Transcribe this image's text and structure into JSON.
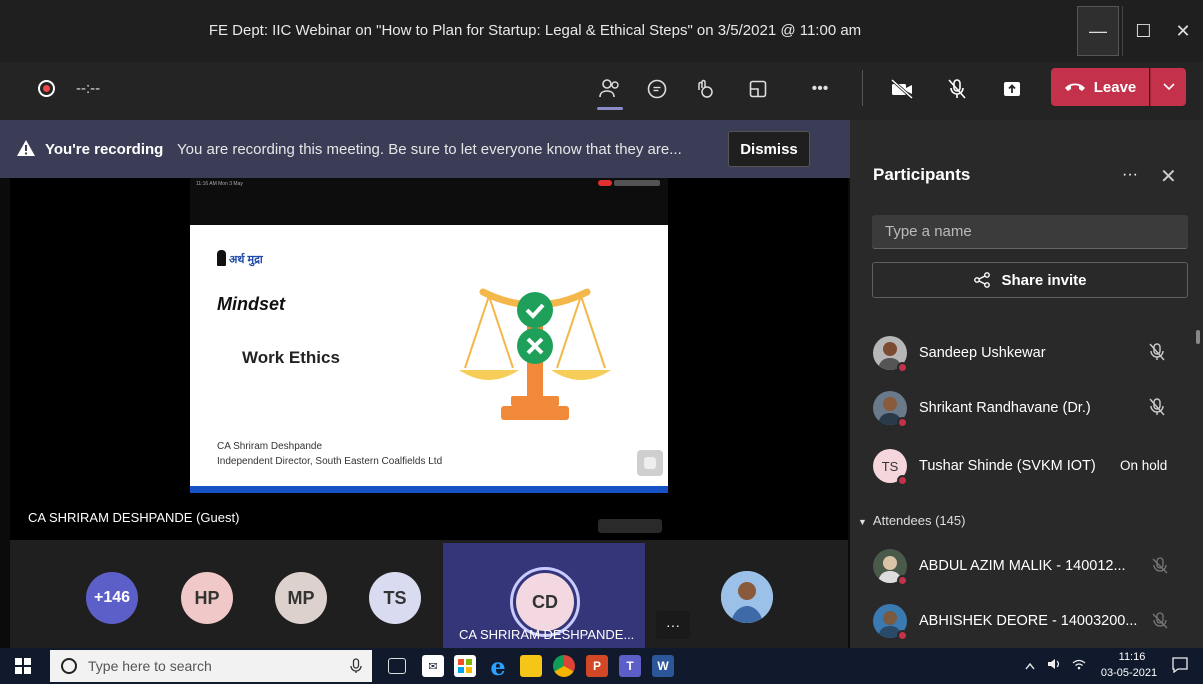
{
  "window": {
    "title": "FE Dept: IIC Webinar on \"How to Plan for Startup: Legal & Ethical Steps\" on 3/5/2021 @ 11:00 am",
    "minimize": "—",
    "maximize": "☐",
    "close": "✕"
  },
  "toolbar": {
    "timer": "--:--",
    "leave_label": "Leave",
    "leave_caret": "⌄",
    "more": "•••"
  },
  "banner": {
    "strong": "You're recording",
    "text": "You are recording this meeting. Be sure to let everyone know that they are...",
    "dismiss": "Dismiss"
  },
  "slide": {
    "logo": "अर्थ मुद्रा",
    "heading": "Mindset",
    "subheading": "Work Ethics",
    "author": "CA Shriram Deshpande",
    "role": "Independent Director, South Eastern Coalfields Ltd",
    "status_left": "11:16 AM  Mon 3 May"
  },
  "stage": {
    "speaker": "CA SHRIRAM DESHPANDE (Guest)"
  },
  "strip": {
    "overflow": "+146",
    "avatars": [
      "HP",
      "MP",
      "TS"
    ],
    "active_initials": "CD",
    "active_name": "CA SHRIRAM DESHPANDE...",
    "more": "···"
  },
  "panel": {
    "title": "Participants",
    "more": "···",
    "close": "✕",
    "search_placeholder": "Type a name",
    "share_invite": "Share invite",
    "participants": [
      {
        "name": "Sandeep Ushkewar",
        "status": ""
      },
      {
        "name": "Shrikant Randhavane (Dr.)",
        "status": ""
      },
      {
        "name": "Tushar Shinde (SVKM IOT)",
        "status": "On hold",
        "initials": "TS"
      }
    ],
    "attendees_header": "Attendees (145)",
    "attendees": [
      {
        "name": "ABDUL AZIM MALIK - 140012..."
      },
      {
        "name": "ABHISHEK DEORE - 14003200..."
      }
    ]
  },
  "taskbar": {
    "search_placeholder": "Type here to search",
    "time": "11:16",
    "date": "03-05-2021"
  },
  "colors": {
    "accent": "#5b5fc7",
    "leave": "#c4314b",
    "banner": "#3b3d56",
    "panel": "#292929"
  }
}
